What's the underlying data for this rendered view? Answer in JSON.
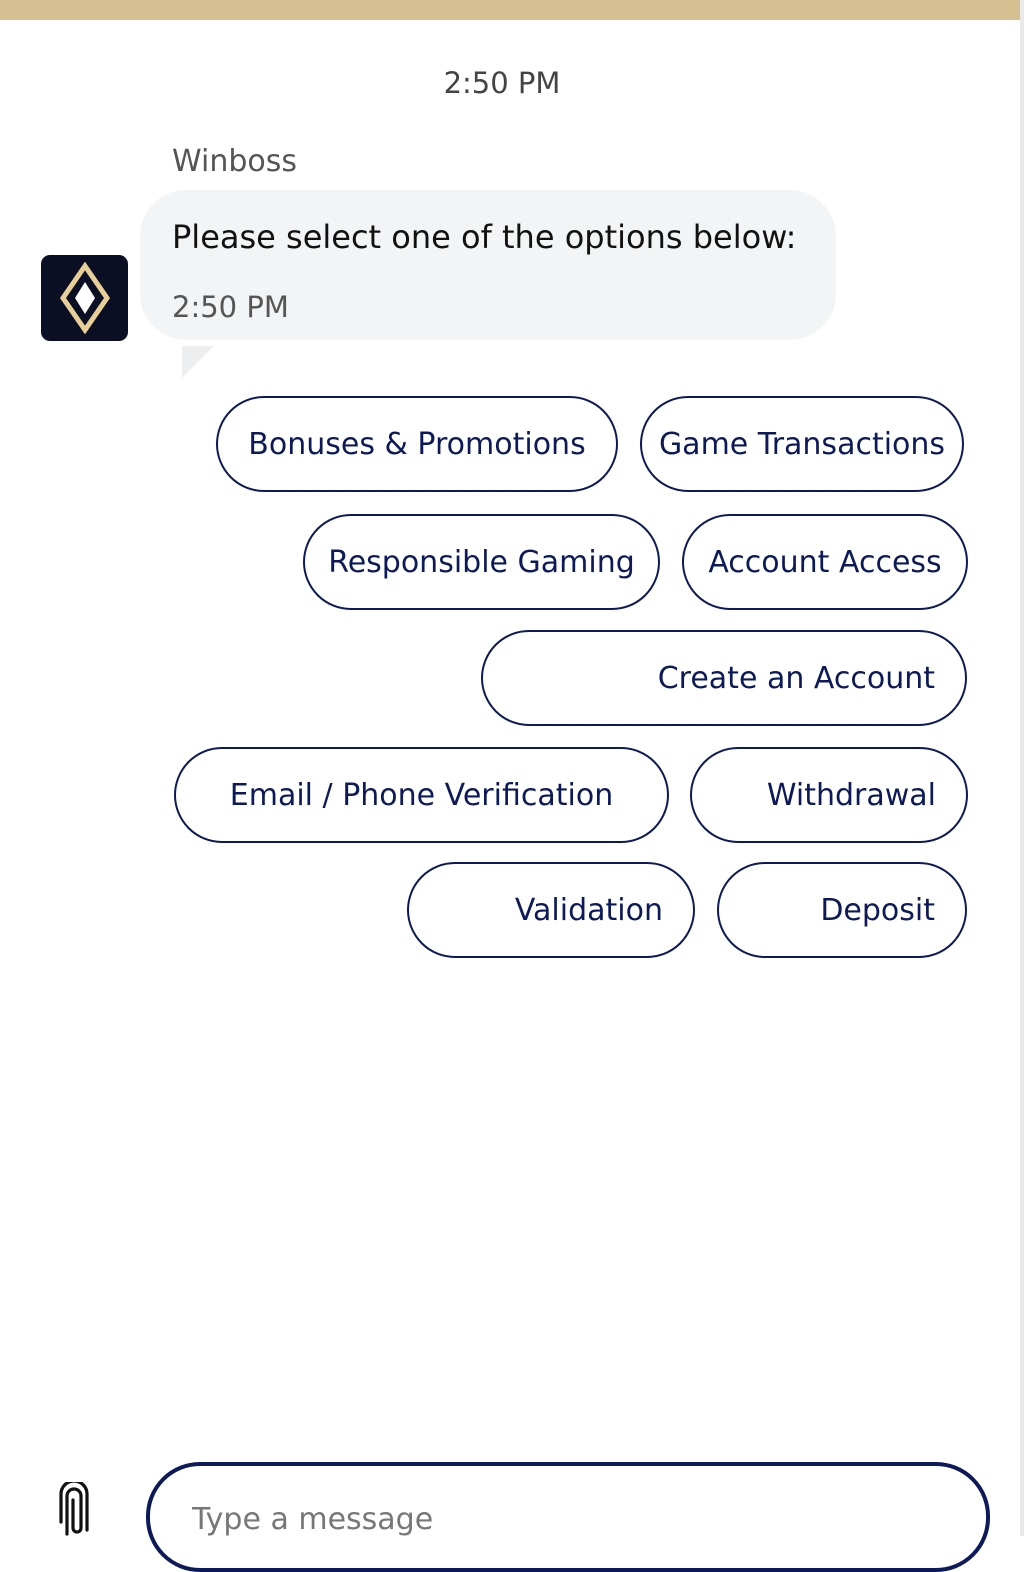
{
  "chat": {
    "top_timestamp": "2:50 PM",
    "sender": "Winboss",
    "message": "Please select one of the options below:",
    "message_time": "2:50 PM"
  },
  "options": {
    "bonuses": "Bonuses & Promotions",
    "game_transactions": "Game Transactions",
    "responsible_gaming": "Responsible Gaming",
    "account_access": "Account Access",
    "create_account": "Create an Account",
    "verification": "Email / Phone Verification",
    "withdrawal": "Withdrawal",
    "validation": "Validation",
    "deposit": "Deposit"
  },
  "composer": {
    "placeholder": "Type a message"
  },
  "icons": {
    "avatar": "diamond-logo-icon",
    "attach": "paperclip-icon"
  },
  "colors": {
    "accent": "#0d1a5a",
    "header": "#d6bf90",
    "bubble": "#f3f4f5",
    "avatar_bg": "#0b0f24",
    "logo_gold": "#e8cf98"
  }
}
